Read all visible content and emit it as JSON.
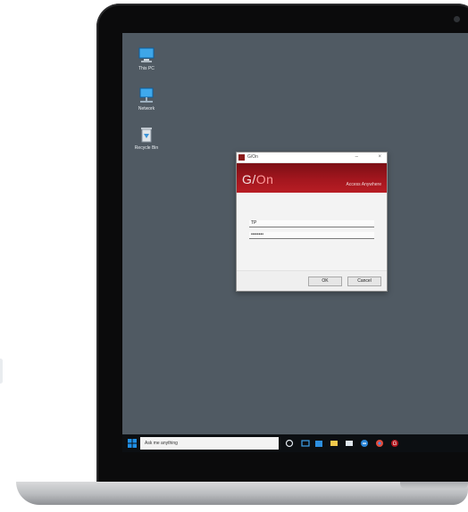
{
  "desktop": {
    "icons": [
      {
        "label": "This PC",
        "icon": "this-pc-icon"
      },
      {
        "label": "Network",
        "icon": "network-icon"
      },
      {
        "label": "Recycle Bin",
        "icon": "recycle-bin-icon"
      }
    ]
  },
  "dialog": {
    "title": "G/On",
    "brand_prefix": "G/",
    "brand_suffix": "On",
    "banner_sub": "Access Anywhere",
    "username_value": "TP",
    "password_value": "••••••••",
    "ok_label": "OK",
    "cancel_label": "Cancel",
    "minimize_glyph": "–",
    "close_glyph": "×"
  },
  "taskbar": {
    "search_placeholder": "Ask me anything",
    "icons": [
      "cortana-icon",
      "task-view-icon",
      "store-icon",
      "file-explorer-icon",
      "edge-icon",
      "chrome-icon",
      "gon-app-icon"
    ]
  },
  "colors": {
    "desktop_bg": "#505a63",
    "banner_red": "#a3161e",
    "taskbar_bg": "#0c0f12"
  }
}
